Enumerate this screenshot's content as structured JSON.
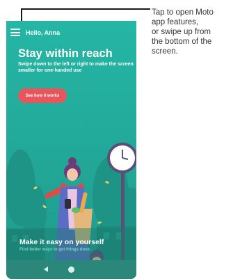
{
  "callout": {
    "lines": [
      "Tap to open Moto",
      "app features,",
      "or swipe up from",
      "the bottom of the",
      "screen."
    ]
  },
  "screen": {
    "greeting": "Hello, Anna",
    "headline": "Stay within reach",
    "subheadline": "Swipe down to the left or right to make the screen smaller for one-handed use",
    "cta_label": "See how it works",
    "bottom_title": "Make it easy on yourself",
    "bottom_subtitle": "Find better ways to get things done"
  },
  "navbar": {
    "back_icon": "back-triangle-icon",
    "home_icon": "home-circle-icon"
  },
  "colors": {
    "screen_background": "#26b3a2",
    "cta_background": "#e8555b",
    "navbar_background": "#2a8779"
  }
}
